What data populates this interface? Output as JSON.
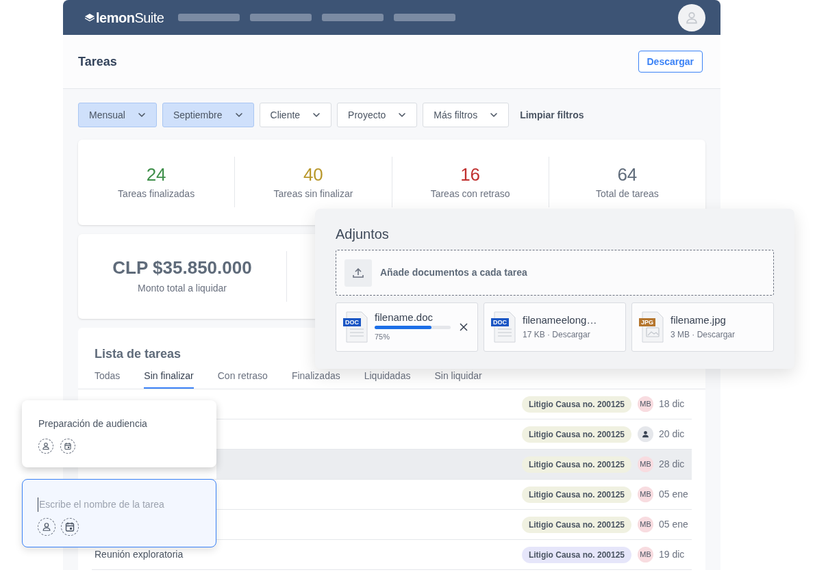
{
  "header": {
    "logo_prefix": "lemon",
    "logo_suffix": "Suite"
  },
  "page": {
    "title": "Tareas",
    "download_button": "Descargar"
  },
  "filters": [
    {
      "label": "Mensual",
      "selected": true
    },
    {
      "label": "Septiembre",
      "selected": true
    },
    {
      "label": "Cliente",
      "selected": false
    },
    {
      "label": "Proyecto",
      "selected": false
    },
    {
      "label": "Más filtros",
      "selected": false
    }
  ],
  "clear_filters": "Limpiar filtros",
  "stats": [
    {
      "value": "24",
      "label": "Tareas finalizadas",
      "color": "#3f8f4a"
    },
    {
      "value": "40",
      "label": "Tareas sin finalizar",
      "color": "#b8972a"
    },
    {
      "value": "16",
      "label": "Tareas con retraso",
      "color": "#c0302f"
    },
    {
      "value": "64",
      "label": "Total de tareas",
      "color": "#5f6b7a"
    }
  ],
  "amount": {
    "value": "CLP $35.850.000",
    "label": "Monto total a liquidar"
  },
  "task_list": {
    "title": "Lista de tareas",
    "tabs": [
      {
        "label": "Todas",
        "selected": false
      },
      {
        "label": "Sin finalizar",
        "selected": true
      },
      {
        "label": "Con retraso",
        "selected": false
      },
      {
        "label": "Finalizadas",
        "selected": false
      },
      {
        "label": "Liquidadas",
        "selected": false
      },
      {
        "label": "Sin liquidar",
        "selected": false
      }
    ],
    "rows": [
      {
        "tag": "Litigio Causa no. 200125",
        "color": "#f0f1e1",
        "assignee": {
          "kind": "initials",
          "initials": "MB"
        },
        "date": "18 dic",
        "highlighted": false
      },
      {
        "tag": "Litigio Causa no. 200125",
        "color": "#f0f1e1",
        "assignee": {
          "kind": "unassigned"
        },
        "date": "20 dic",
        "highlighted": false
      },
      {
        "tag": "Litigio Causa no. 200125",
        "color": "#f0f1e1",
        "assignee": {
          "kind": "initials",
          "initials": "MB"
        },
        "date": "28 dic",
        "highlighted": true
      },
      {
        "tag": "Litigio Causa no. 200125",
        "color": "#f0f1e1",
        "assignee": {
          "kind": "initials",
          "initials": "MB"
        },
        "date": "05 ene",
        "highlighted": false
      },
      {
        "tag": "Litigio Causa no. 200125",
        "color": "#f0f1e1",
        "assignee": {
          "kind": "initials",
          "initials": "MB"
        },
        "date": "05 ene",
        "highlighted": false
      },
      {
        "name": "Reunión exploratoria",
        "tag": "Litigio Causa no. 200125",
        "color": "#e6e6fa",
        "assignee": {
          "kind": "initials",
          "initials": "MB"
        },
        "date": "19 dic",
        "highlighted": false
      }
    ]
  },
  "attachments": {
    "title": "Adjuntos",
    "dropzone": "Añade documentos a cada tarea",
    "files": [
      {
        "kind": "uploading",
        "type_label": "DOC",
        "color": "#1a56c4",
        "name": "filename.doc",
        "level": 0.75,
        "progress": "75%"
      },
      {
        "kind": "done",
        "type_label": "DOC",
        "color": "#1a56c4",
        "name": "filenameelong…",
        "meta": "17 KB · Descargar"
      },
      {
        "kind": "done",
        "type_label": "JPG",
        "color": "#b5762e",
        "name": "filename.jpg",
        "meta": "3 MB · Descargar"
      }
    ]
  },
  "task_cards": [
    {
      "kind": "task",
      "name": "Preparación de audiencia"
    },
    {
      "kind": "input",
      "placeholder": "Escribe el nombre de la tarea"
    }
  ]
}
